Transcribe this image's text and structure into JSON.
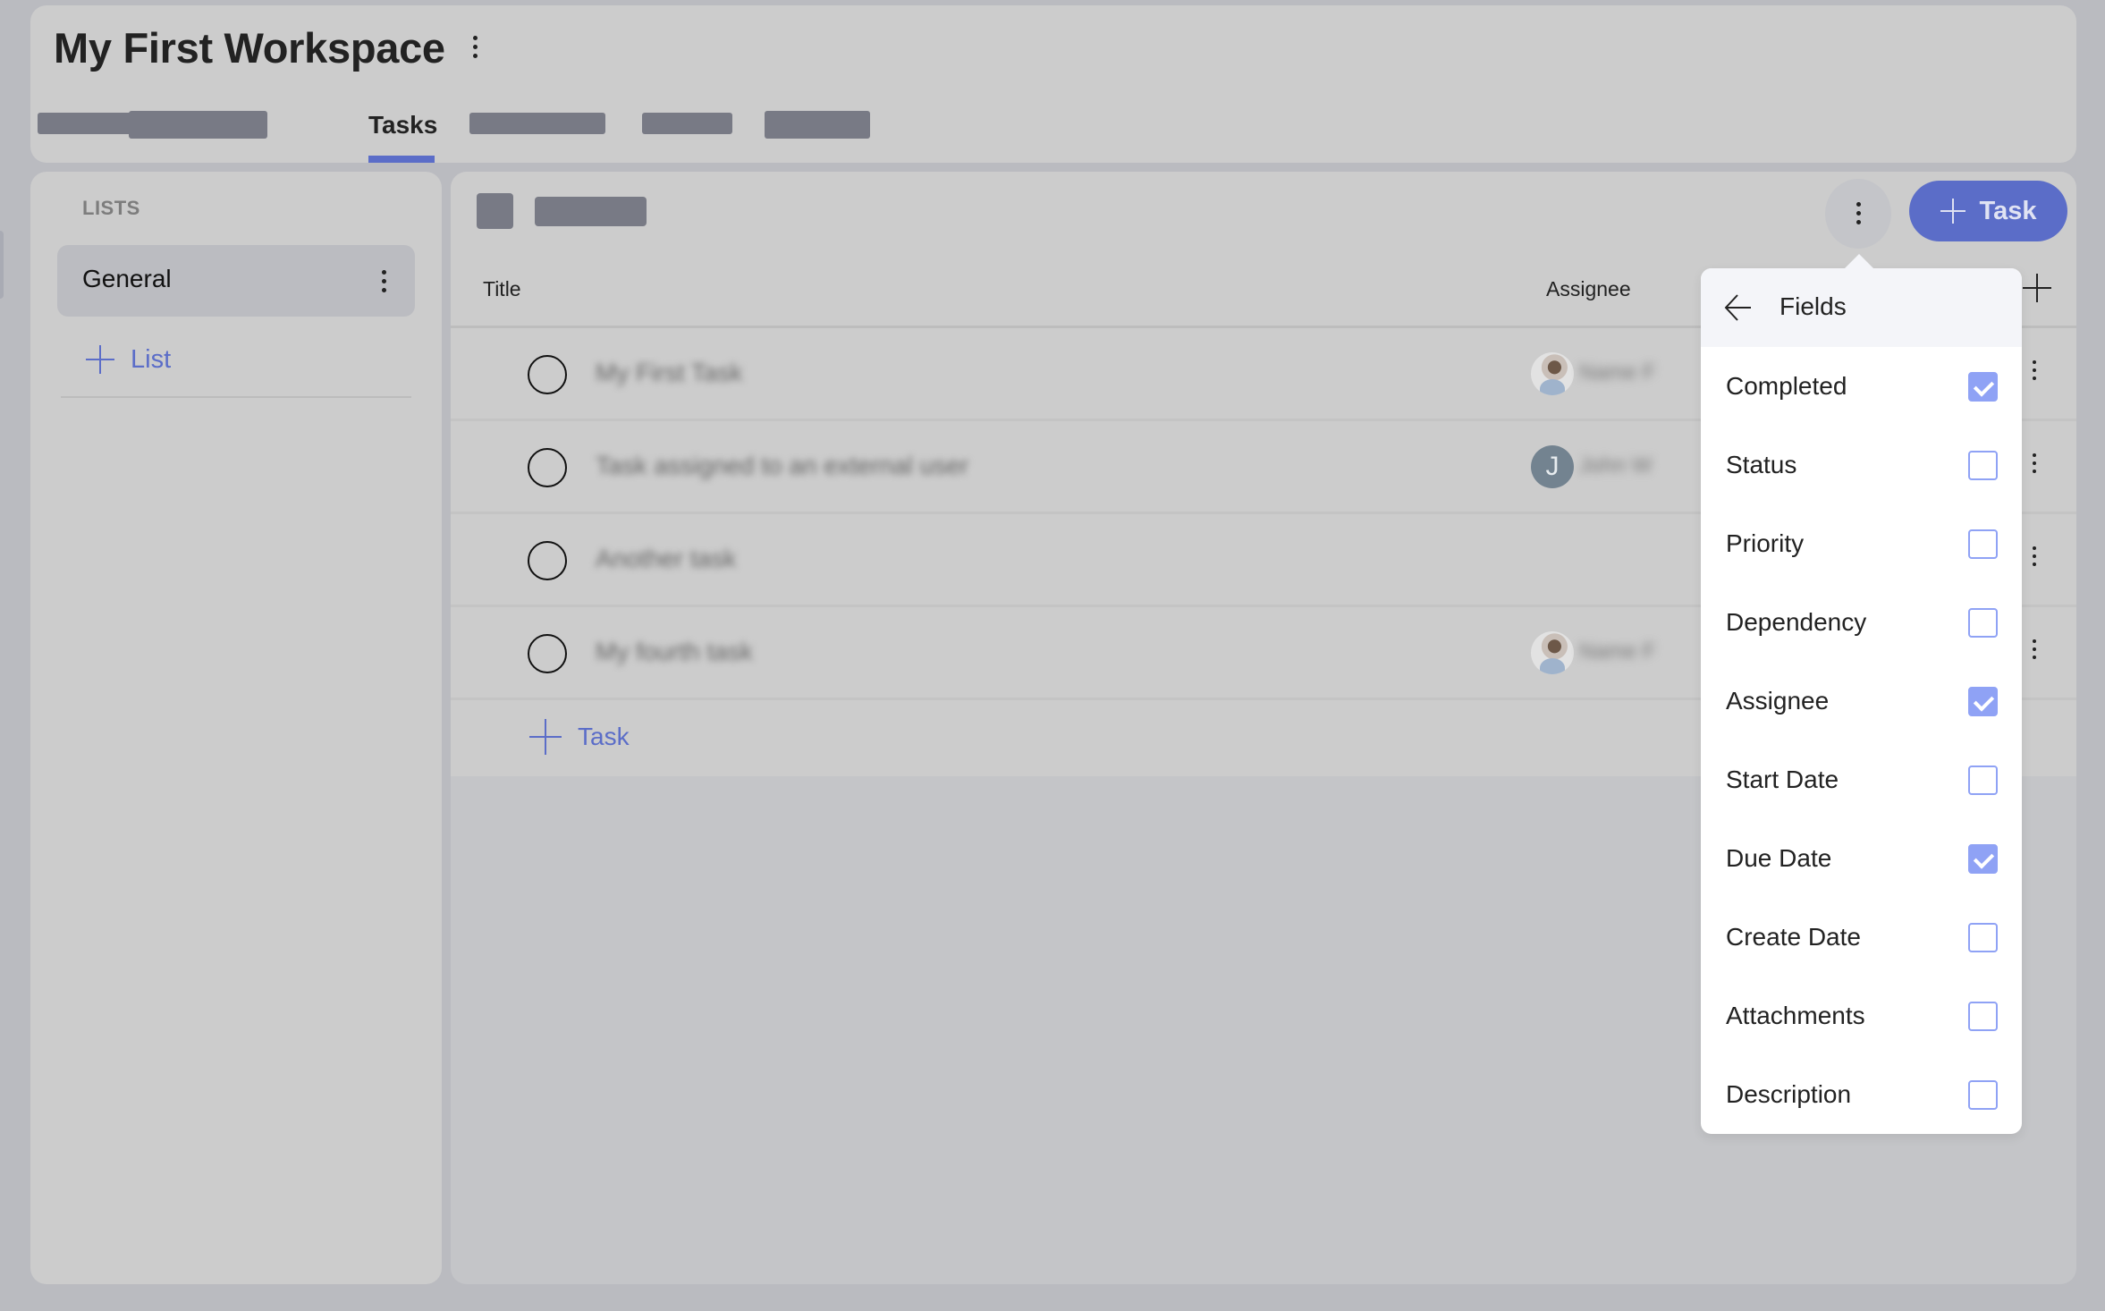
{
  "workspace": {
    "title": "My First Workspace",
    "menu_icon": "more-vertical-icon"
  },
  "tabs": {
    "active_label": "Tasks",
    "redacted_tab_count": 5
  },
  "sidebar": {
    "section_label": "LISTS",
    "lists": [
      {
        "label": "General",
        "selected": true
      }
    ],
    "add_list_label": "List"
  },
  "main": {
    "columns": {
      "title": "Title",
      "assignee": "Assignee"
    },
    "add_task_button_label": "Task",
    "add_task_inline_label": "Task",
    "tasks": [
      {
        "title": "My First Task",
        "completed": false,
        "assignee": {
          "name": "Name F",
          "avatar": "photo"
        }
      },
      {
        "title": "Task assigned to an external user",
        "completed": false,
        "assignee": {
          "name": "John W",
          "avatar": "initial",
          "initial": "J"
        }
      },
      {
        "title": "Another task",
        "completed": false,
        "assignee": null
      },
      {
        "title": "My fourth task",
        "completed": false,
        "assignee": {
          "name": "Name F",
          "avatar": "photo"
        }
      }
    ]
  },
  "fields_popover": {
    "title": "Fields",
    "fields": [
      {
        "label": "Completed",
        "checked": true
      },
      {
        "label": "Status",
        "checked": false
      },
      {
        "label": "Priority",
        "checked": false
      },
      {
        "label": "Dependency",
        "checked": false
      },
      {
        "label": "Assignee",
        "checked": true
      },
      {
        "label": "Start Date",
        "checked": false
      },
      {
        "label": "Due Date",
        "checked": true
      },
      {
        "label": "Create Date",
        "checked": false
      },
      {
        "label": "Attachments",
        "checked": false
      },
      {
        "label": "Description",
        "checked": false
      }
    ]
  },
  "colors": {
    "accent": "#5b6dc8",
    "checkbox": "#8fa2f5",
    "overlay_background": "#babbc0",
    "card_background": "#cccccc",
    "redacted_placeholder": "#787a85"
  }
}
